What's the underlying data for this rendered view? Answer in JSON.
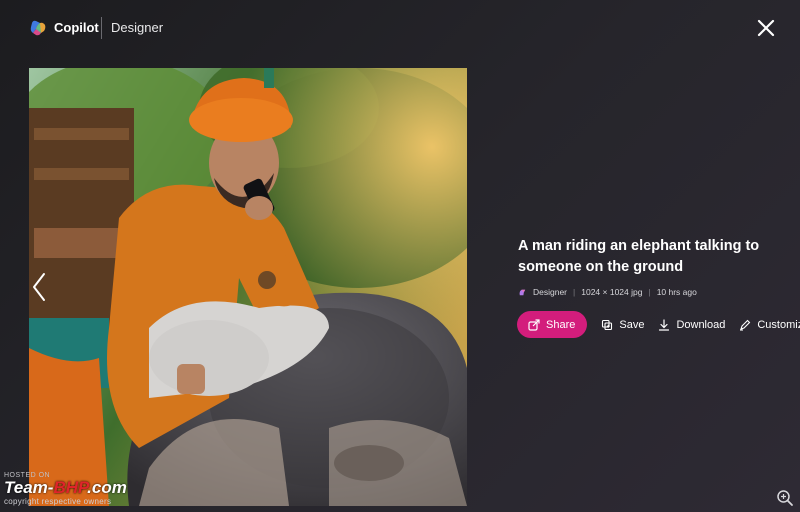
{
  "header": {
    "brand": "Copilot",
    "product": "Designer"
  },
  "image": {
    "caption": "A man riding an elephant talking to someone on the ground",
    "meta": {
      "app": "Designer",
      "dimensions": "1024 × 1024 jpg",
      "time": "10 hrs ago"
    }
  },
  "actions": {
    "share": "Share",
    "save": "Save",
    "download": "Download",
    "customize": "Customize"
  },
  "watermark": {
    "hosted": "HOSTED ON",
    "site_part1": "Team-",
    "site_part2": "BHP",
    "site_part3": ".com",
    "copyright": "copyright respective owners"
  },
  "colors": {
    "share_accent": "#d31d7c",
    "background": "#232227"
  },
  "icons": [
    "copilot-logo-icon",
    "close-icon",
    "chevron-left-icon",
    "share-icon",
    "save-icon",
    "download-icon",
    "customize-icon",
    "designer-icon",
    "zoom-icon"
  ]
}
